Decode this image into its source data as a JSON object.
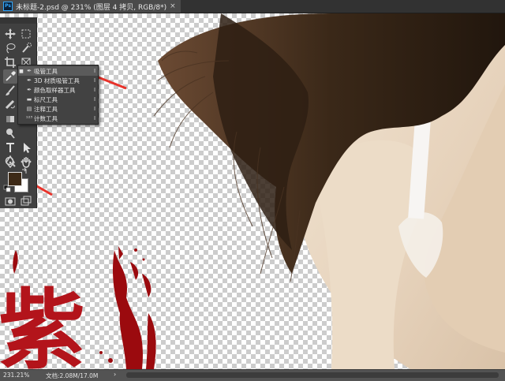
{
  "document": {
    "tab_title": "未标题-2.psd @ 231% (图层 4 拷贝, RGB/8*)",
    "close_glyph": "×",
    "app_icon_text": "Ps"
  },
  "canvas_text": "紫",
  "toolbar": {
    "tools": [
      {
        "icon": "move-icon"
      },
      {
        "icon": "rectangular-marquee-icon"
      },
      {
        "icon": "lasso-icon"
      },
      {
        "icon": "quick-selection-icon"
      },
      {
        "icon": "crop-icon"
      },
      {
        "icon": "frame-icon"
      },
      {
        "icon": "eyedropper-icon"
      },
      {
        "icon": "brush-icon"
      },
      {
        "icon": "healing-brush-icon"
      },
      {
        "icon": "eraser-icon"
      },
      {
        "icon": "dodge-icon"
      },
      {
        "icon": "type-icon"
      },
      {
        "icon": "path-selection-icon"
      },
      {
        "icon": "pen-icon"
      },
      {
        "icon": "hand-icon"
      },
      {
        "icon": "zoom-icon"
      },
      {
        "icon": "more-tools-icon"
      },
      {
        "icon": "quick-mask-icon"
      },
      {
        "icon": "screen-mode-icon"
      }
    ],
    "foreground_color": "#3d2a17",
    "background_color": "#ffffff"
  },
  "flyout": {
    "items": [
      {
        "label": "吸管工具",
        "shortcut": "I",
        "selected": true,
        "icon": "eyedropper-icon"
      },
      {
        "label": "3D 材质吸管工具",
        "shortcut": "I",
        "selected": false,
        "icon": "3d-material-eyedropper-icon"
      },
      {
        "label": "颜色取样器工具",
        "shortcut": "I",
        "selected": false,
        "icon": "color-sampler-icon"
      },
      {
        "label": "标尺工具",
        "shortcut": "I",
        "selected": false,
        "icon": "ruler-icon"
      },
      {
        "label": "注释工具",
        "shortcut": "I",
        "selected": false,
        "icon": "note-icon"
      },
      {
        "label": "计数工具",
        "shortcut": "I",
        "selected": false,
        "icon": "count-icon"
      }
    ]
  },
  "statusbar": {
    "zoom": "231.21%",
    "doc_info": "文档:2.08M/17.0M",
    "arrow": "›"
  },
  "colors": {
    "annotation_arrow": "#e8322a",
    "ui_dark": "#404040"
  }
}
